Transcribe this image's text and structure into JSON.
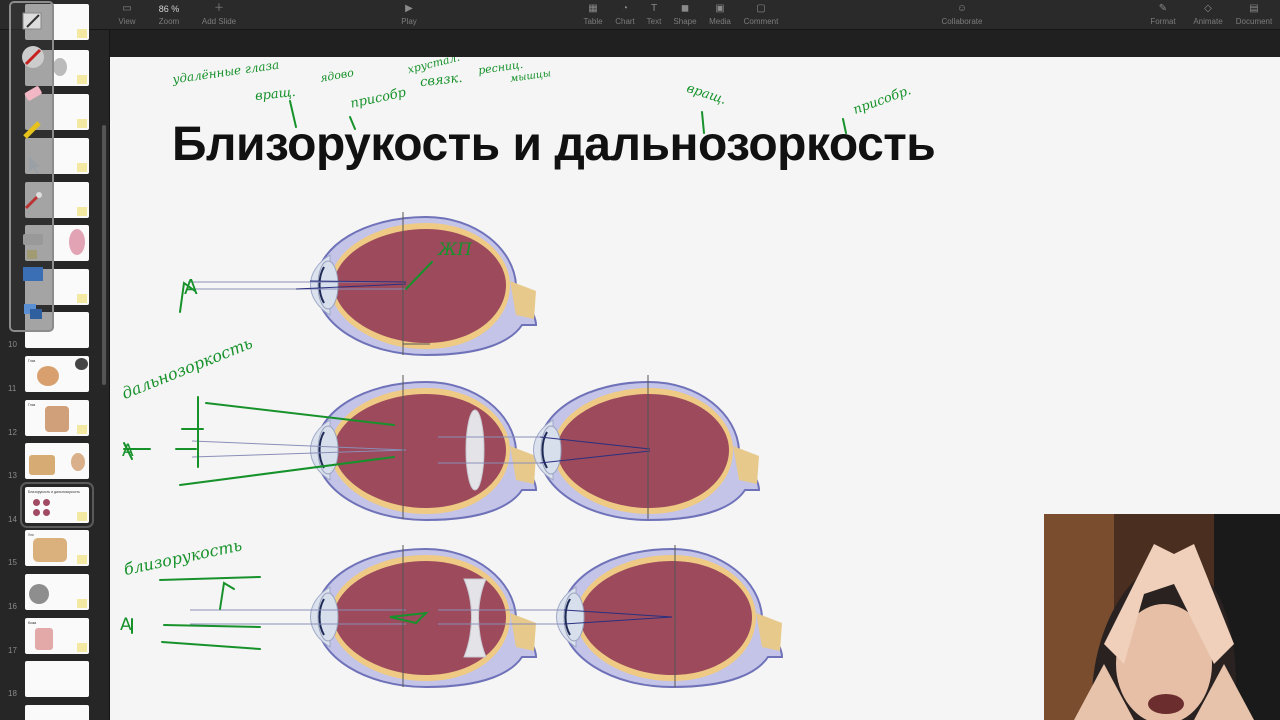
{
  "toolbar": {
    "items": [
      {
        "label": "View",
        "icon": "sidebar-icon"
      },
      {
        "label": "Zoom",
        "value": "86 %",
        "icon": "zoom-icon"
      },
      {
        "label": "Add Slide",
        "icon": "add-slide-icon"
      },
      {
        "label": "Play",
        "icon": "play-icon"
      },
      {
        "label": "Table",
        "icon": "table-icon"
      },
      {
        "label": "Chart",
        "icon": "chart-icon"
      },
      {
        "label": "Text",
        "icon": "text-icon"
      },
      {
        "label": "Shape",
        "icon": "shape-icon"
      },
      {
        "label": "Media",
        "icon": "media-icon"
      },
      {
        "label": "Comment",
        "icon": "comment-icon"
      },
      {
        "label": "Collaborate",
        "icon": "collaborate-icon"
      },
      {
        "label": "Format",
        "icon": "format-icon"
      },
      {
        "label": "Animate",
        "icon": "animate-icon"
      },
      {
        "label": "Document",
        "icon": "document-icon"
      }
    ]
  },
  "sidebar": {
    "slides": [
      {
        "num": "",
        "title": ""
      },
      {
        "num": "",
        "title": ""
      },
      {
        "num": "",
        "title": ""
      },
      {
        "num": "",
        "title": ""
      },
      {
        "num": "",
        "title": ""
      },
      {
        "num": "",
        "title": ""
      },
      {
        "num": "",
        "title": ""
      },
      {
        "num": "10",
        "title": ""
      },
      {
        "num": "11",
        "title": "Глаз"
      },
      {
        "num": "12",
        "title": "Глаз"
      },
      {
        "num": "13",
        "title": ""
      },
      {
        "num": "14",
        "title": "Близорукость и дальнозоркость"
      },
      {
        "num": "15",
        "title": "Ухо"
      },
      {
        "num": "16",
        "title": ""
      },
      {
        "num": "17",
        "title": "Кожа"
      },
      {
        "num": "18",
        "title": ""
      },
      {
        "num": "",
        "title": ""
      }
    ]
  },
  "slide": {
    "title": "Близорукость и дальнозоркость",
    "annotations": {
      "a1": "удалённые глаза",
      "a2": "ядово",
      "a3": "вращ.",
      "a4": "присобр",
      "a5": "хрустал.",
      "a6": "связк.",
      "a7": "ресниц.",
      "a8": "мышцы",
      "a9": "вращ.",
      "a10": "присобр.",
      "jp": "ЖП",
      "farsight": "дальнозоркость",
      "nearsight": "близорукость",
      "letterA1": "A",
      "letterA2": "A",
      "letterA3": "A"
    }
  },
  "colors": {
    "ink": "#17922b",
    "eye_inner": "#9c4a5c",
    "eye_outer": "#6f72b8",
    "eye_yellow": "#efca84",
    "nerve": "#e7c98b"
  }
}
